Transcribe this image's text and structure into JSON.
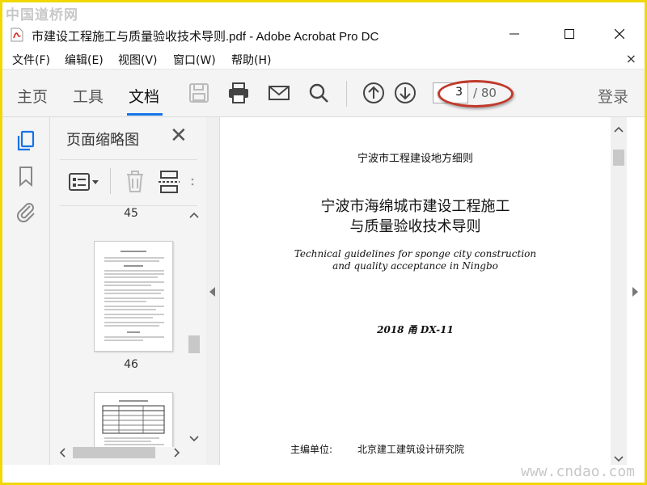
{
  "watermark": {
    "top": "中国道桥网",
    "bottom": "www.cndao.com"
  },
  "window": {
    "title": "市建设工程施工与质量验收技术导则.pdf - Adobe Acrobat Pro DC"
  },
  "menu": {
    "items": [
      "文件(F)",
      "编辑(E)",
      "视图(V)",
      "窗口(W)",
      "帮助(H)"
    ],
    "close": "×"
  },
  "toolbar": {
    "tabs": [
      {
        "label": "主页"
      },
      {
        "label": "工具"
      },
      {
        "label": "文档",
        "active": true
      }
    ],
    "current_page": "3",
    "total_pages": "/ 80",
    "login": "登录"
  },
  "thumbnails": {
    "title": "页面缩略图",
    "close": "✕",
    "page_labels": [
      "45",
      "46"
    ]
  },
  "document": {
    "header": "宁波市工程建设地方细则",
    "title_lines": [
      "宁波市海绵城市建设工程施工",
      "与质量验收技术导则"
    ],
    "english_lines": [
      "Technical guidelines for sponge city construction",
      "and quality acceptance in Ningbo"
    ],
    "code": "2018 甬  DX-11",
    "editor_label": "主编单位:",
    "editor_value": "北京建工建筑设计研究院"
  },
  "colors": {
    "accent": "#1473e6",
    "annotation": "#c0392b",
    "frame": "#f0d800"
  }
}
